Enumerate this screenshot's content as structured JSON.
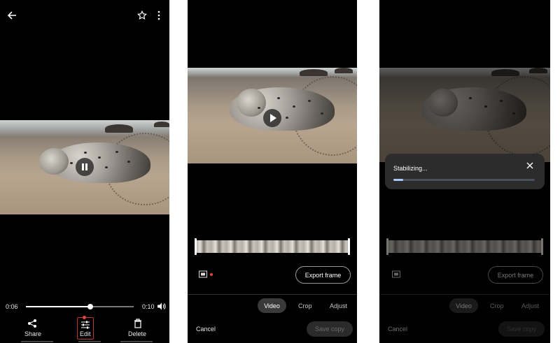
{
  "viewer": {
    "time_current": "0:06",
    "time_total": "0:10",
    "playback_progress": 0.6,
    "actions": [
      {
        "key": "share",
        "label": "Share",
        "icon": "share-icon"
      },
      {
        "key": "edit",
        "label": "Edit",
        "icon": "tune-icon"
      },
      {
        "key": "delete",
        "label": "Delete",
        "icon": "trash-icon"
      }
    ]
  },
  "editor": {
    "export_frame_label": "Export frame",
    "tabs": [
      "Video",
      "Crop",
      "Adjust"
    ],
    "active_tab": "Video",
    "cancel_label": "Cancel",
    "save_copy_label": "Save copy"
  },
  "stabilize": {
    "status_text": "Stabilizing...",
    "progress": 0.07,
    "export_frame_label": "Export frame",
    "tabs": [
      "Video",
      "Crop",
      "Adjust"
    ],
    "cancel_label": "Cancel",
    "save_copy_label": "Save copy"
  },
  "colors": {
    "background": "#000000",
    "progress_fill": "#a8c7fa",
    "highlight_dot": "#e0473e",
    "highlight_box": "#c0392b"
  }
}
